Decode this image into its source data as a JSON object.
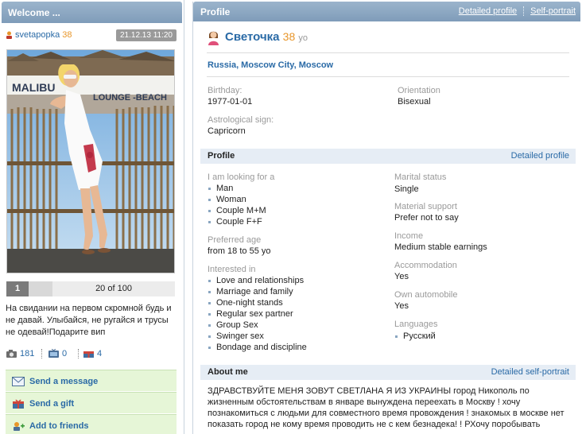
{
  "left": {
    "header": "Welcome ...",
    "username": "svetapopka",
    "age": "38",
    "date": "21.12.13 11:20",
    "photo": {
      "sign_left": "MALIBU",
      "sign_right": "LOUNGE -BEACH"
    },
    "pager": {
      "current": "1",
      "count": "20 of 100"
    },
    "caption": "На свидании на первом скромной будь и не давай. Улыбайся, не ругайся и трусы не одевай!Подарите вип",
    "stats": {
      "photos": "181",
      "videos": "0",
      "gifts": "4"
    },
    "actions": [
      {
        "label": "Send a message",
        "icon": "envelope-icon"
      },
      {
        "label": "Send a gift",
        "icon": "gift-icon"
      },
      {
        "label": "Add to friends",
        "icon": "add-friend-icon"
      }
    ]
  },
  "right": {
    "header": "Profile",
    "links": {
      "detailed_profile": "Detailed profile",
      "self_portrait": "Self-portrait"
    },
    "name": "Светочка",
    "age": "38",
    "age_unit": "yo",
    "location": "Russia, Moscow City, Moscow",
    "birthday": {
      "label": "Birthday:",
      "value": "1977-01-01"
    },
    "orientation": {
      "label": "Orientation",
      "value": "Bisexual"
    },
    "astro": {
      "label": "Astrological sign:",
      "value": "Capricorn"
    },
    "profile_section": {
      "title": "Profile",
      "link": "Detailed profile"
    },
    "looking_for": {
      "label": "I am looking for a",
      "items": [
        "Man",
        "Woman",
        "Couple M+M",
        "Couple F+F"
      ]
    },
    "preferred_age": {
      "label": "Preferred age",
      "value": "from 18 to 55 yo"
    },
    "interested_in": {
      "label": "Interested in",
      "items": [
        "Love and relationships",
        "Marriage and family",
        "One-night stands",
        "Regular sex partner",
        "Group Sex",
        "Swinger sex",
        "Bondage and discipline"
      ]
    },
    "marital": {
      "label": "Marital status",
      "value": "Single"
    },
    "material": {
      "label": "Material support",
      "value": "Prefer not to say"
    },
    "income": {
      "label": "Income",
      "value": "Medium stable earnings"
    },
    "accommodation": {
      "label": "Accommodation",
      "value": "Yes"
    },
    "automobile": {
      "label": "Own automobile",
      "value": "Yes"
    },
    "languages": {
      "label": "Languages",
      "items": [
        "Русский"
      ]
    },
    "about_section": {
      "title": "About me",
      "link": "Detailed self-portrait"
    },
    "about_text": "ЗДРАВСТВУЙТЕ МЕНЯ ЗОВУТ СВЕТЛАНА Я ИЗ УКРАИНЫ город Никополь по жизненным обстоятельствам в январе вынуждена переехать в Москву ! хочу познакомиться с людьми для совместного время провождения ! знакомых в москве нет показать город не кому время проводить не с кем безнадека! ! РХочу поробывать разные виды секса"
  },
  "colors": {
    "link": "#2a6aa6",
    "age": "#e8962a",
    "header": "#8aa6c1",
    "action_bg": "#e6f6d7",
    "section_bg": "#e6edf5"
  }
}
